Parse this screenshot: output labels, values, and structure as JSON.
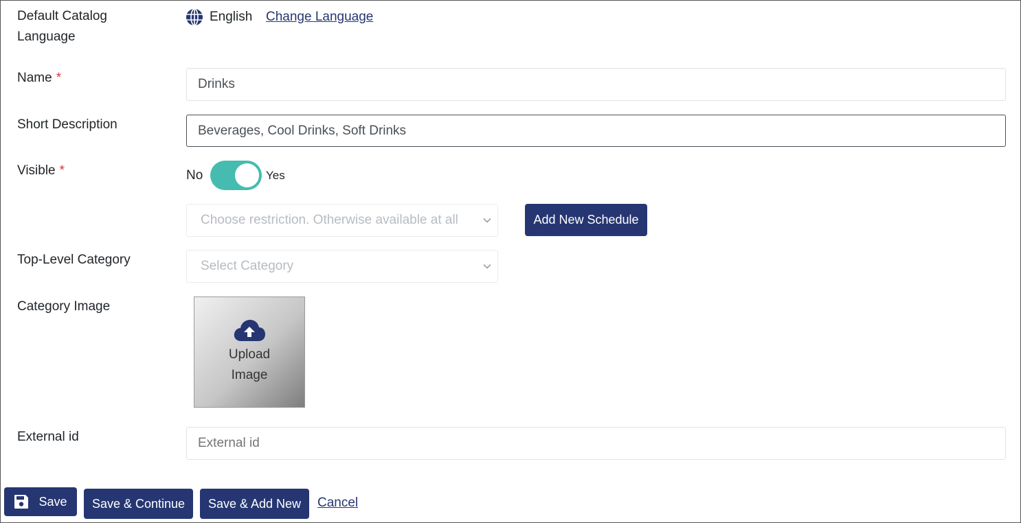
{
  "colors": {
    "primary": "#263672",
    "toggle_on": "#46bcb0",
    "required": "#dc3545"
  },
  "language": {
    "label_line1": "Default Catalog",
    "label_line2": "Language",
    "icon": "globe-icon",
    "value": "English",
    "change_link": "Change Language"
  },
  "name": {
    "label": "Name",
    "required_mark": "*",
    "value": "Drinks"
  },
  "short_description": {
    "label": "Short Description",
    "value": "Beverages, Cool Drinks, Soft Drinks"
  },
  "visible": {
    "label": "Visible",
    "required_mark": "*",
    "off_label": "No",
    "on_label": "Yes",
    "checked": true
  },
  "schedule": {
    "restriction_placeholder": "Choose restriction. Otherwise available at all",
    "add_button": "Add New Schedule"
  },
  "top_category": {
    "label": "Top-Level Category",
    "placeholder": "Select Category"
  },
  "category_image": {
    "label": "Category Image",
    "icon": "cloud-upload-icon",
    "upload_line1": "Upload",
    "upload_line2": "Image"
  },
  "external_id": {
    "label": "External id",
    "placeholder": "External id"
  },
  "actions": {
    "save": "Save",
    "save_icon": "floppy-disk-icon",
    "save_continue": "Save & Continue",
    "save_add_new": "Save & Add New",
    "cancel": "Cancel"
  }
}
